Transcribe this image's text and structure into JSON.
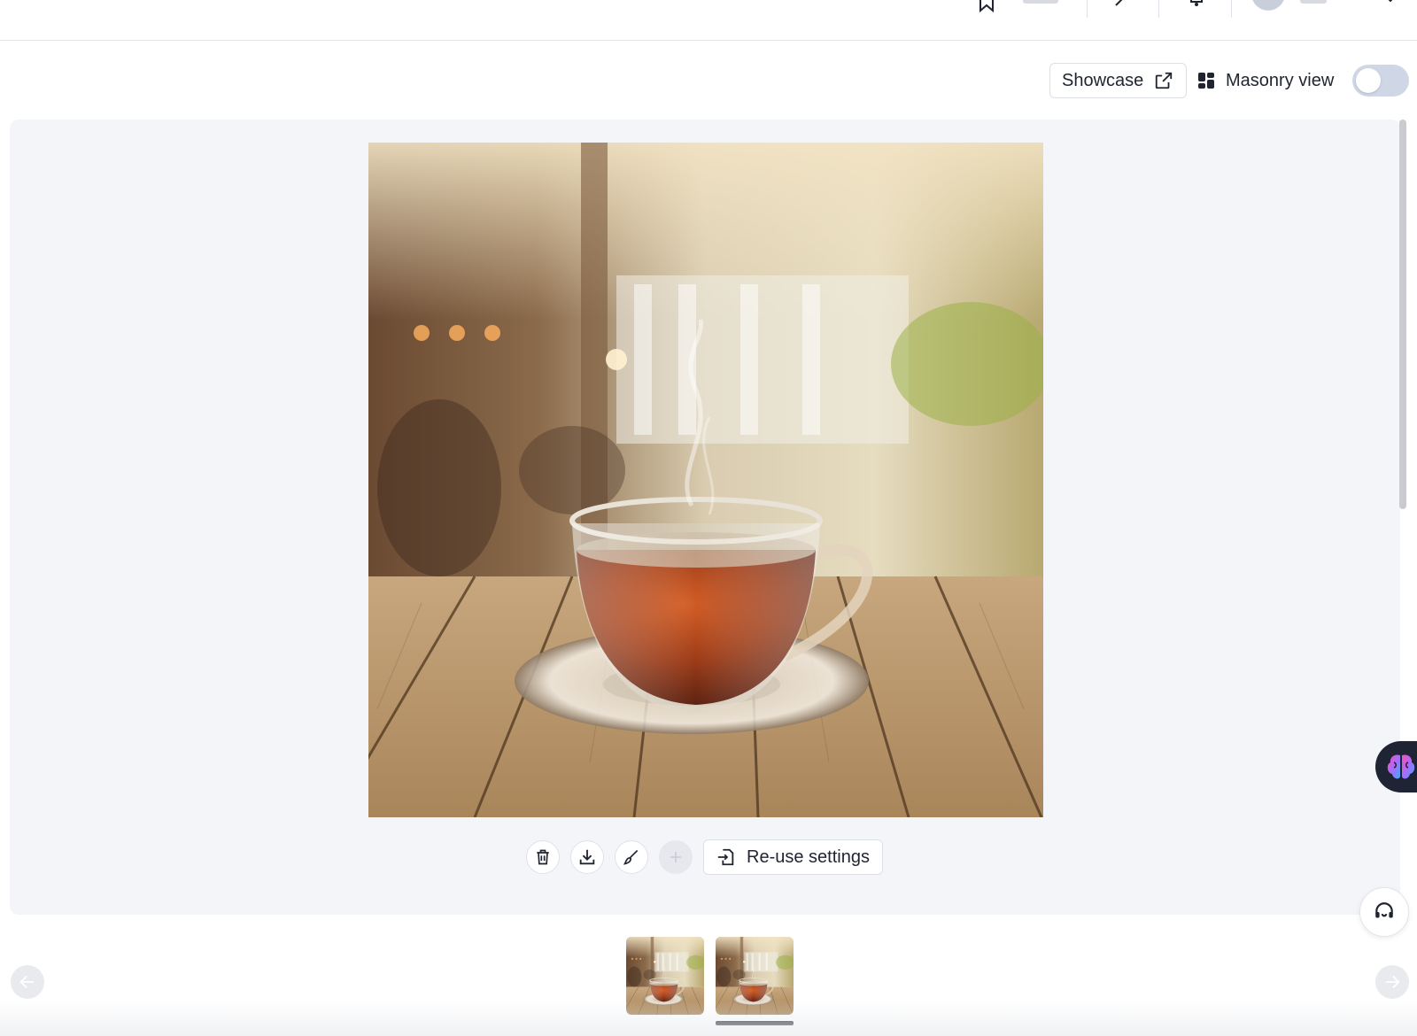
{
  "header": {
    "icons": [
      "bookmark-icon",
      "wand-icon",
      "bell-icon",
      "user-avatar",
      "chevron-down-icon"
    ]
  },
  "toolbar": {
    "showcase_label": "Showcase",
    "showcase_icon": "external-link-icon",
    "masonry_label": "Masonry view",
    "masonry_icon": "masonry-grid-icon",
    "masonry_enabled": false
  },
  "gallery": {
    "main_image": "tea-cup-on-wooden-table-cafe",
    "actions": {
      "delete_icon": "trash-icon",
      "download_icon": "download-icon",
      "edit_icon": "brush-icon",
      "add_icon": "plus-icon",
      "reuse_label": "Re-use settings",
      "reuse_icon": "reuse-settings-icon"
    },
    "thumbnails": [
      {
        "image": "tea-cup-thumbnail-1",
        "selected": false
      },
      {
        "image": "tea-cup-thumbnail-2",
        "selected": true
      }
    ]
  },
  "widgets": {
    "assistant_icon": "brain-icon",
    "support_icon": "headset-icon",
    "prev_icon": "arrow-left-icon",
    "next_icon": "arrow-right-icon"
  },
  "colors": {
    "panel_bg": "#f4f5f8",
    "text": "#1f2430",
    "toggle_off": "#cfd7e6",
    "tea": "#8a2a08"
  }
}
